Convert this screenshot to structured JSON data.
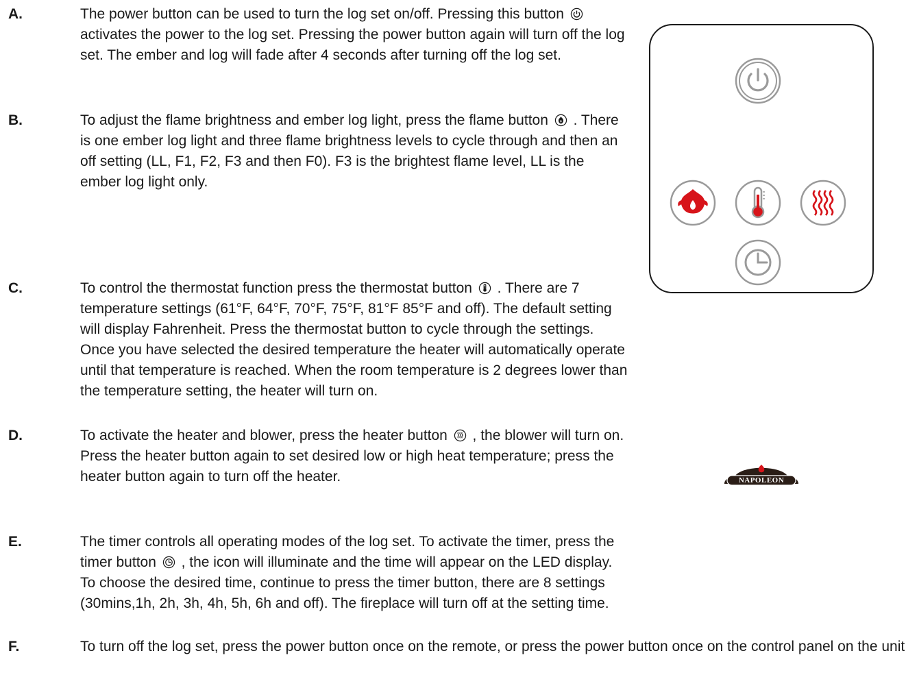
{
  "items": [
    {
      "letter": "A.",
      "parts": [
        "The power button can be used to turn the log set on/off. Pressing this button",
        "activates the power to the log set. Pressing the power button again will turn off the log set. The ember and log will fade after 4 seconds after turning off the log set."
      ],
      "icon": "power-icon"
    },
    {
      "letter": "B.",
      "parts": [
        "To adjust the flame brightness and ember log light, press the flame button",
        ". There is one ember log light and three flame brightness levels to cycle through and then an off setting (LL, F1, F2, F3 and then F0). F3 is the brightest flame level, LL is the ember log light only."
      ],
      "icon": "flame-icon"
    },
    {
      "letter": "C.",
      "parts": [
        "To control the thermostat function press the thermostat button",
        ". There are 7 temperature settings (61°F, 64°F, 70°F, 75°F, 81°F 85°F and off). The default setting will display Fahrenheit. Press the thermostat button to cycle through the settings. Once you have selected the desired temperature the heater will automatically operate until that temperature is reached. When the room temperature is 2 degrees lower than the temperature setting, the heater will turn on."
      ],
      "icon": "thermometer-icon"
    },
    {
      "letter": "D.",
      "parts": [
        "To activate the heater and blower, press the heater button",
        ", the blower will turn on. Press the heater button again to set desired low or high heat temperature; press the heater button again to turn off the heater."
      ],
      "icon": "heat-waves-icon"
    },
    {
      "letter": "E.",
      "parts": [
        "The timer controls all operating modes of the log set. To activate the timer, press the timer button",
        ", the icon will illuminate and the time will appear on the LED display. To choose the desired time, continue to press the timer button, there are 8 settings (30mins,1h, 2h, 3h, 4h, 5h, 6h and off). The fireplace will turn off at the setting time."
      ],
      "icon": "timer-icon"
    },
    {
      "letter": "F.",
      "parts": [
        "To turn off the log set, press the power button once on the remote, or press the power button once on the control panel on the unit."
      ]
    }
  ],
  "remote": {
    "logo_text": "NAPOLEON",
    "buttons": [
      "power-icon",
      "flame-icon",
      "thermometer-icon",
      "heat-waves-icon",
      "timer-icon"
    ]
  },
  "colors": {
    "text": "#1a1a1a",
    "button_ring": "#9a9a9a",
    "flame_red": "#d7141a",
    "logo_dark": "#2a1d16"
  }
}
